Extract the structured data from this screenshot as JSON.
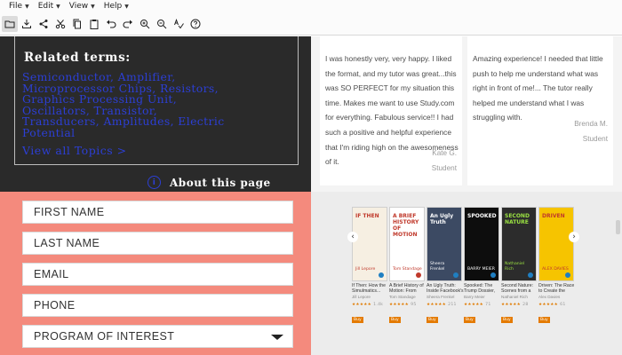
{
  "menu": [
    "File",
    "Edit",
    "View",
    "Help"
  ],
  "toolbar_icons": [
    "folder-open-icon",
    "download-icon",
    "share-icon",
    "scissors-icon",
    "copy-icon",
    "paste-icon",
    "undo-icon",
    "redo-icon",
    "zoom-in-icon",
    "zoom-out-icon",
    "spellcheck-icon",
    "help-icon"
  ],
  "related": {
    "title": "Related terms:",
    "lines": [
      "Semiconductor, Amplifier,",
      "Microprocessor Chips, Resistors,",
      "Graphics Processing Unit,",
      "Oscillators, Transistor,",
      "Transducers, Amplitudes, Electric",
      "Potential"
    ],
    "view_all": "View all Topics  >",
    "about": "About this page",
    "about_icon": "i"
  },
  "reviews": [
    {
      "text": "I was honestly very, very happy. I liked the format, and my tutor was great...this was SO PERFECT for my situation this time. Makes me want to use Study.com for everything. Fabulous service!! I had such a positive and helpful experience that I'm riding high on the awesomeness of it.",
      "name": "Kate G.",
      "role": "Student"
    },
    {
      "text": "Amazing experience! I needed that little push to help me understand what was right in front of me!... The tutor really helped me understand what I was struggling with.",
      "name": "Brenda M.",
      "role": "Student"
    }
  ],
  "form": {
    "first_name": "FIRST NAME",
    "last_name": "LAST NAME",
    "email": "EMAIL",
    "phone": "PHONE",
    "program": "PROGRAM OF INTEREST"
  },
  "books": [
    {
      "cover_title": "IF THEN",
      "cover_sub": "Jill Lepore",
      "title": "If Then: How the Simulmatics...",
      "author": "Jill Lepore",
      "stars": "★★★★★",
      "count": "1.4k",
      "bg": "#f6efe2",
      "fg": "#c0392b",
      "badge": "#1f7fc2"
    },
    {
      "cover_title": "A BRIEF HISTORY OF MOTION",
      "cover_sub": "Tom Standage",
      "title": "A Brief History of Motion: From the...",
      "author": "Tom Standage",
      "stars": "★★★★★",
      "count": "95",
      "bg": "#ffffff",
      "fg": "#c0392b",
      "badge": "#c0392b"
    },
    {
      "cover_title": "An Ugly Truth",
      "cover_sub": "Sheera Frenkel",
      "title": "An Ugly Truth: Inside Facebook's Battle for...",
      "author": "Sheera Frenkel",
      "stars": "★★★★★",
      "count": "211",
      "bg": "#3c4a63",
      "fg": "#ffffff",
      "badge": "#1f7fc2"
    },
    {
      "cover_title": "SPOOKED",
      "cover_sub": "BARRY MEIER",
      "title": "Spooked: The Trump Dossier, Black Cube,...",
      "author": "Barry Meier",
      "stars": "★★★★★",
      "count": "71",
      "bg": "#0d0d0d",
      "fg": "#ffffff",
      "badge": "#1f7fc2"
    },
    {
      "cover_title": "SECOND NATURE",
      "cover_sub": "Nathaniel Rich",
      "title": "Second Nature: Scenes from a World Remade",
      "author": "Nathaniel Rich",
      "stars": "★★★★★",
      "count": "28",
      "bg": "#2c2c2c",
      "fg": "#9be342",
      "badge": "#1f7fc2"
    },
    {
      "cover_title": "DRIVEN",
      "cover_sub": "ALEX DAVIES",
      "title": "Driven: The Race to Create the Autonomous...",
      "author": "Alex Davies",
      "stars": "★★★★★",
      "count": "61",
      "bg": "#f6c400",
      "fg": "#c0392b",
      "badge": "#1f7fc2"
    }
  ],
  "buy_label": "Buy"
}
